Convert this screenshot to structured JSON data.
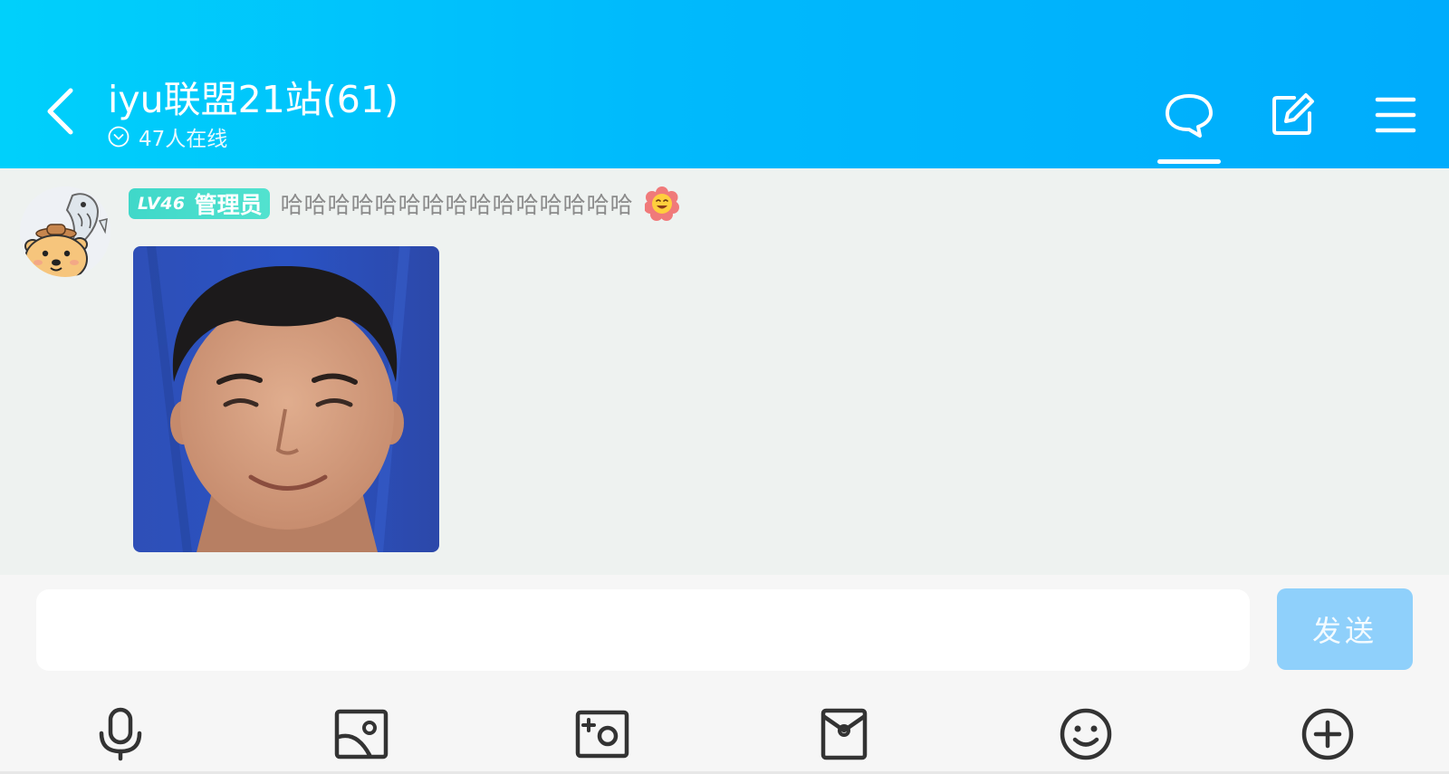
{
  "header": {
    "title": "iyu联盟21站(61)",
    "online_status": "47人在线",
    "icons": {
      "back": "chevron-left-icon",
      "status": "chevron-down-circle-icon",
      "chat": "speech-bubble-icon",
      "edit": "edit-square-icon",
      "menu": "hamburger-menu-icon"
    },
    "active_tab": "chat"
  },
  "message": {
    "level_badge": "LV46",
    "role": "管理员",
    "sender": "哈哈哈哈哈哈哈哈哈哈哈哈哈哈哈",
    "sender_icon": "flower-emoji-icon",
    "avatar": "cartoon-bear-avatar",
    "content_type": "image"
  },
  "input": {
    "placeholder": "",
    "value": "",
    "send_label": "发送"
  },
  "toolbar": {
    "items": [
      "microphone-icon",
      "image-icon",
      "camera-icon",
      "red-packet-icon",
      "emoji-icon",
      "plus-icon"
    ]
  },
  "colors": {
    "header_start": "#00d0fb",
    "header_end": "#00acfc",
    "badge": "#3fd8c9",
    "send_button": "#8fd0fb",
    "chat_background": "#eef2f0"
  }
}
